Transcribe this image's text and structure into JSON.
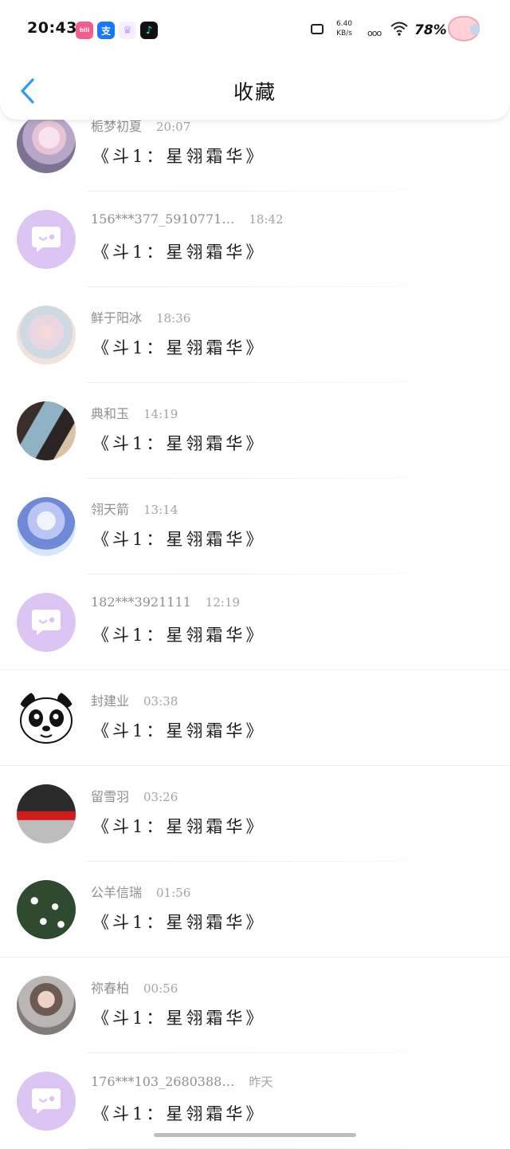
{
  "status_bar": {
    "time": "20:43",
    "app_icons": [
      {
        "name": "bilibili-icon",
        "glyph": "bili"
      },
      {
        "name": "alipay-icon",
        "glyph": "支"
      },
      {
        "name": "crown-icon",
        "glyph": "♛"
      },
      {
        "name": "tiktok-icon",
        "glyph": "♪"
      }
    ],
    "net_speed_value": "6.40",
    "net_speed_unit": "KB/s",
    "network_type": "ooo",
    "battery": "78%"
  },
  "header": {
    "title": "收藏",
    "back_icon": "chevron-left-icon",
    "accent_color": "#2f9bf0"
  },
  "favorites": [
    {
      "avatar": "anime-pink",
      "name": "栀梦初夏",
      "time": "20:07",
      "book": "《斗1：星翎霜华》"
    },
    {
      "avatar": "default",
      "name": "156***377_5910771…",
      "time": "18:42",
      "book": "《斗1：星翎霜华》"
    },
    {
      "avatar": "watercolor",
      "name": "鲜于阳冰",
      "time": "18:36",
      "book": "《斗1：星翎霜华》"
    },
    {
      "avatar": "couple",
      "name": "典和玉",
      "time": "14:19",
      "book": "《斗1：星翎霜华》"
    },
    {
      "avatar": "anime-white",
      "name": "翎天箭",
      "time": "13:14",
      "book": "《斗1：星翎霜华》"
    },
    {
      "avatar": "default",
      "name": "182***3921111",
      "time": "12:19",
      "book": "《斗1：星翎霜华》"
    },
    {
      "avatar": "panda",
      "name": "封建业",
      "time": "03:38",
      "book": "《斗1：星翎霜华》"
    },
    {
      "avatar": "woman-red",
      "name": "留雪羽",
      "time": "03:26",
      "book": "《斗1：星翎霜华》"
    },
    {
      "avatar": "flowers",
      "name": "公羊信瑞",
      "time": "01:56",
      "book": "《斗1：星翎霜华》"
    },
    {
      "avatar": "boy",
      "name": "祢春柏",
      "time": "00:56",
      "book": "《斗1：星翎霜华》"
    },
    {
      "avatar": "default",
      "name": "176***103_2680388…",
      "time": "昨天",
      "book": "《斗1：星翎霜华》"
    }
  ],
  "colors": {
    "default_avatar_bg": "#dcc5f3",
    "meta_text": "#8f8f8f"
  }
}
